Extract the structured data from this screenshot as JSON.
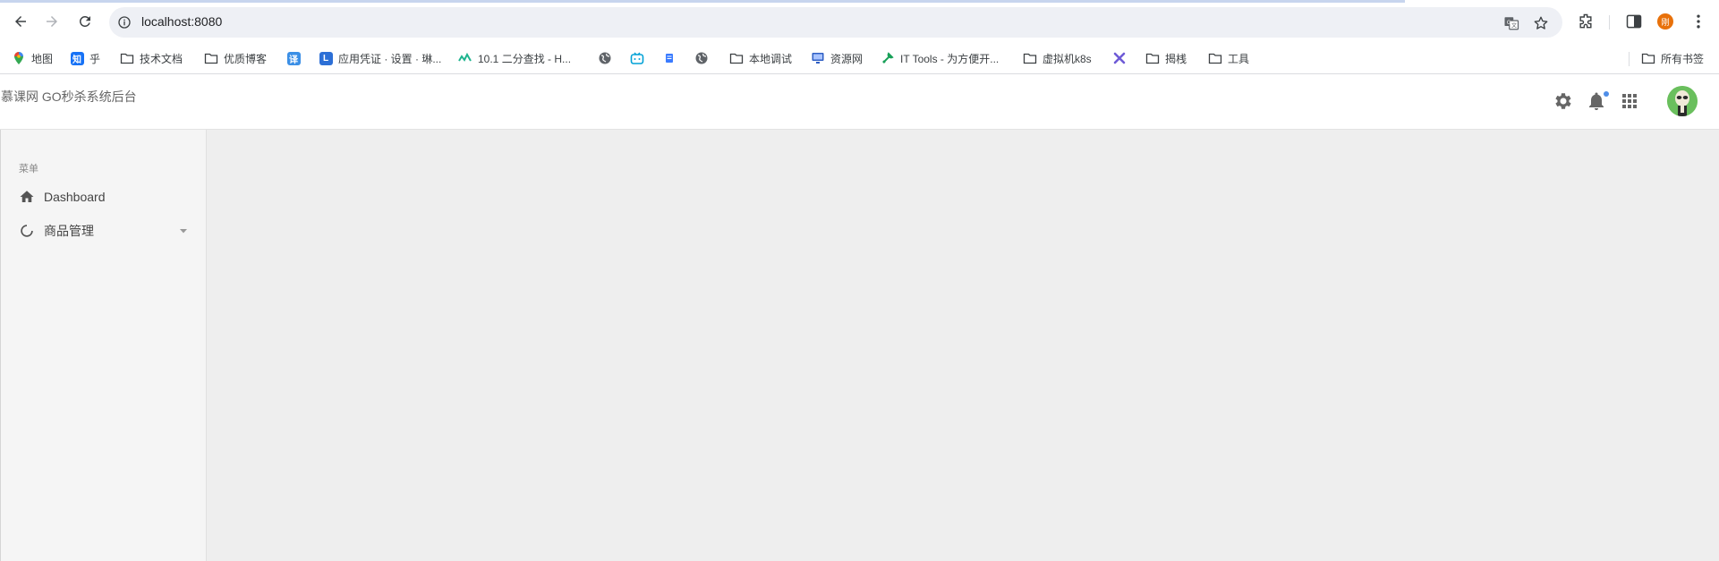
{
  "browser": {
    "url": "localhost:8080",
    "profile_initial": "刚",
    "bookmarks": [
      {
        "label": "地图",
        "icon": "maps-icon"
      },
      {
        "label": "乎",
        "icon": "zhihu-icon",
        "icon_text": "知",
        "color": "#1772f6"
      },
      {
        "label": "技术文档",
        "icon": "folder-icon"
      },
      {
        "label": "优质博客",
        "icon": "folder-icon"
      },
      {
        "label": "",
        "icon": "translate-icon",
        "icon_text": "译",
        "color": "#3b8fe6"
      },
      {
        "label": "应用凭证 · 设置 · 琳...",
        "icon": "l-app-icon",
        "icon_text": "L",
        "color": "#2c6fd6"
      },
      {
        "label": "10.1   二分查找 - H...",
        "icon": "hello-algo-icon"
      },
      {
        "label": "",
        "icon": "globe-icon"
      },
      {
        "label": "",
        "icon": "bilibili-icon"
      },
      {
        "label": "",
        "icon": "blue-doc-icon"
      },
      {
        "label": "",
        "icon": "globe-icon"
      },
      {
        "label": "本地调试",
        "icon": "folder-icon"
      },
      {
        "label": "资源网",
        "icon": "monitor-icon"
      },
      {
        "label": "IT Tools - 为方便开...",
        "icon": "it-tools-icon"
      },
      {
        "label": "虚拟机k8s",
        "icon": "folder-icon"
      },
      {
        "label": "",
        "icon": "cross-tool-icon"
      },
      {
        "label": "揭桟",
        "icon": "folder-icon"
      },
      {
        "label": "工具",
        "icon": "folder-icon"
      }
    ],
    "all_bookmarks_label": "所有书签"
  },
  "app": {
    "title": "慕课网 GO秒杀系统后台",
    "menu_section": "菜单",
    "menu": [
      {
        "label": "Dashboard",
        "icon": "home-icon",
        "has_submenu": false
      },
      {
        "label": "商品管理",
        "icon": "loading-circle-icon",
        "has_submenu": true
      }
    ]
  },
  "colors": {
    "accent": "#4f8ee8",
    "avatar_bg": "#6abf5d",
    "profile": "#e8710a"
  }
}
